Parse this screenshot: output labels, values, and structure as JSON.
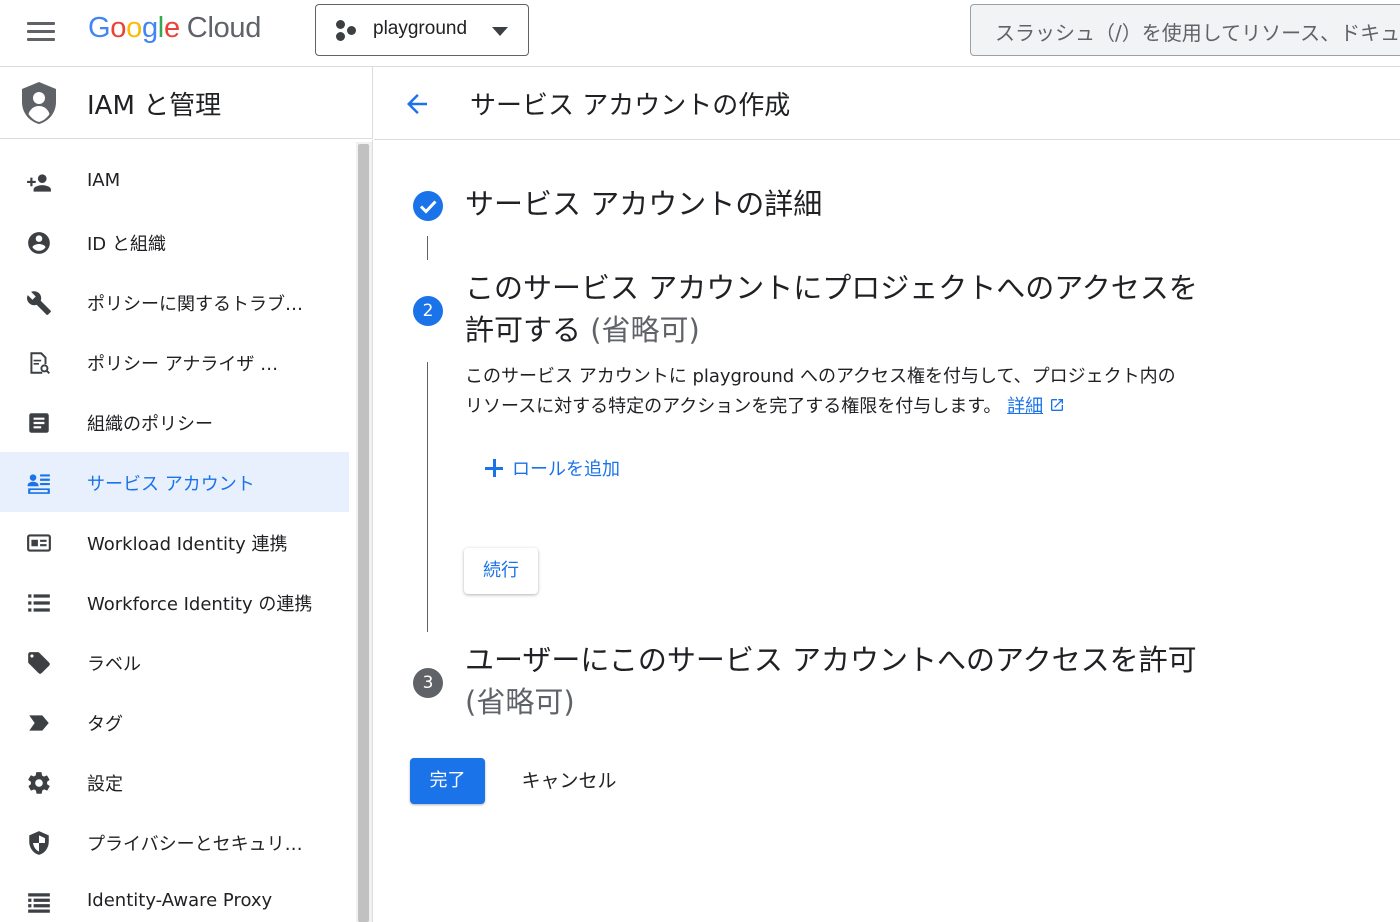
{
  "colors": {
    "accent": "#1a73e8",
    "active_bg": "#e8f0fe",
    "step_pending": "#5f6368"
  },
  "topbar": {
    "menu_icon": "hamburger-menu-icon",
    "logo": {
      "google": "Google",
      "cloud": "Cloud"
    },
    "project": {
      "name": "playground",
      "icon": "project-dots-icon"
    },
    "search": {
      "placeholder": "スラッシュ（/）を使用してリソース、ドキュメント、プロダクトなどを検索"
    }
  },
  "sidebar": {
    "header": {
      "title": "IAM と管理",
      "icon": "iam-shield-icon"
    },
    "items": [
      {
        "label": "IAM",
        "icon": "person-add-icon"
      },
      {
        "label": "ID と組織",
        "icon": "account-circle-icon"
      },
      {
        "label": "ポリシーに関するトラブ…",
        "icon": "wrench-icon"
      },
      {
        "label": "ポリシー アナライザ …",
        "icon": "document-search-icon"
      },
      {
        "label": "組織のポリシー",
        "icon": "article-icon"
      },
      {
        "label": "サービス アカウント",
        "icon": "service-account-icon",
        "active": true
      },
      {
        "label": "Workload Identity 連携",
        "icon": "id-card-icon"
      },
      {
        "label": "Workforce Identity の連携",
        "icon": "list-icon"
      },
      {
        "label": "ラベル",
        "icon": "label-tag-icon"
      },
      {
        "label": "タグ",
        "icon": "tag-arrow-icon"
      },
      {
        "label": "設定",
        "icon": "gear-icon"
      },
      {
        "label": "プライバシーとセキュリ…",
        "icon": "security-shield-icon"
      },
      {
        "label": "Identity-Aware Proxy",
        "icon": "proxy-icon"
      }
    ]
  },
  "page": {
    "back_icon": "arrow-back-icon",
    "title": "サービス アカウントの作成",
    "steps": [
      {
        "status": "complete",
        "title": "サービス アカウントの詳細"
      },
      {
        "number": "2",
        "title": "このサービス アカウントにプロジェクトへのアクセスを許可する",
        "optional": "(省略可)"
      },
      {
        "number": "3",
        "title": "ユーザーにこのサービス アカウントへのアクセスを許可",
        "optional": "(省略可)"
      }
    ],
    "step2": {
      "description_1": "このサービス アカウントに playground へのアクセス権を付与して、プロジェクト内のリソースに対する特定のアクションを完了する権限を付与します。",
      "details_link": "詳細",
      "add_role": "ロールを追加",
      "continue": "続行"
    },
    "actions": {
      "done": "完了",
      "cancel": "キャンセル"
    }
  }
}
